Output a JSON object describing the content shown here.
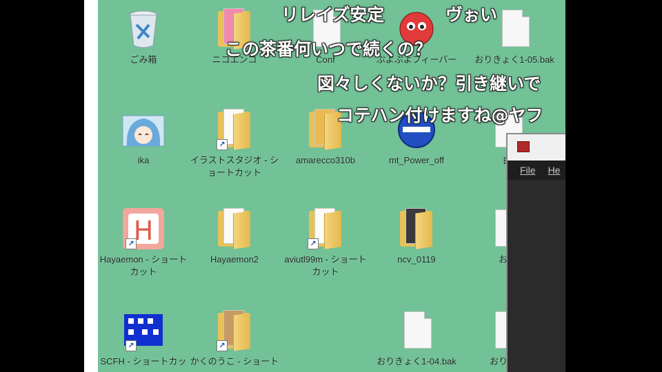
{
  "desktop": {
    "icons": [
      {
        "label": "ごみ箱",
        "icon": "recycle-bin-icon"
      },
      {
        "label": "ニコエンコ",
        "icon": "folder-icon"
      },
      {
        "label": "Conf",
        "icon": "document-icon"
      },
      {
        "label": "ぷよぷよフィーバー",
        "icon": "game-icon"
      },
      {
        "label": "おりきょく1-05.bak",
        "icon": "document-icon"
      },
      {
        "label": "ika",
        "icon": "image-icon"
      },
      {
        "label": "イラストスタジオ - ショートカット",
        "icon": "folder-shortcut-icon"
      },
      {
        "label": "amarecco310b",
        "icon": "folder-icon"
      },
      {
        "label": "mt_Power_off",
        "icon": "power-off-icon"
      },
      {
        "label": "曲",
        "icon": "document-icon"
      },
      {
        "label": "Hayaemon - ショートカット",
        "icon": "hayaemon-icon"
      },
      {
        "label": "Hayaemon2",
        "icon": "folder-icon"
      },
      {
        "label": "aviutl99m - ショートカット",
        "icon": "folder-shortcut-icon"
      },
      {
        "label": "ncv_0119",
        "icon": "folder-icon"
      },
      {
        "label": "おり",
        "icon": "document-icon"
      },
      {
        "label": "SCFH - ショートカッ",
        "icon": "scfh-icon"
      },
      {
        "label": "かくのうこ - ショート",
        "icon": "folder-shortcut-icon"
      },
      {
        "label": "おりきょく1-04.bak",
        "icon": "document-icon"
      },
      {
        "label": "おりきょ",
        "icon": "document-icon"
      }
    ]
  },
  "comments": [
    {
      "text": "リレイズ安定"
    },
    {
      "text": "ヴぉい"
    },
    {
      "text": "この茶番何いつで続くの？"
    },
    {
      "text": "図々しくないか？引き継いで"
    },
    {
      "text": "コテハン付けますね@ヤフ"
    }
  ],
  "window": {
    "menu_file": "File",
    "menu_help": "He"
  },
  "colors": {
    "desktop_background": "#72c197",
    "folder": "#e7c15a",
    "comment_text": "#ffffff"
  }
}
